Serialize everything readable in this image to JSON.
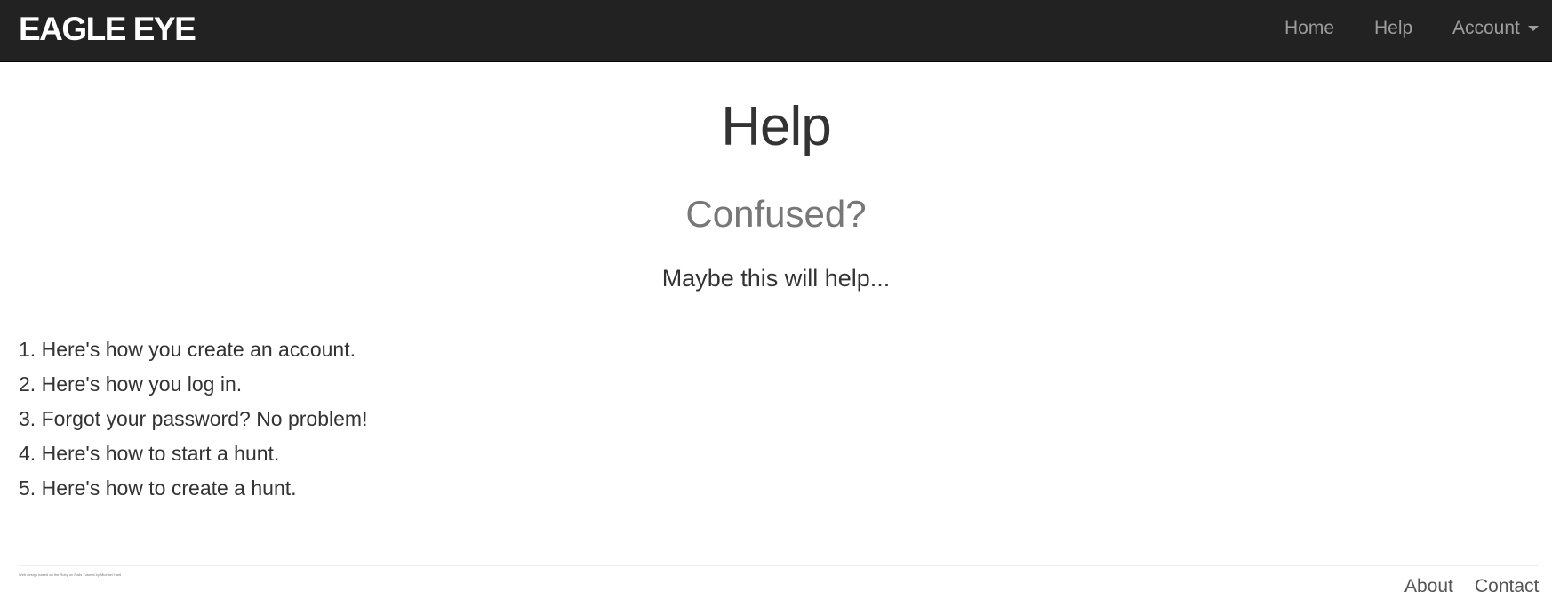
{
  "header": {
    "brand": "EAGLE EYE",
    "nav": {
      "home": "Home",
      "help": "Help",
      "account": "Account"
    }
  },
  "main": {
    "title": "Help",
    "subtitle": "Confused?",
    "intro": "Maybe this will help...",
    "items": [
      {
        "number": "1.",
        "text": "Here's how you create an account."
      },
      {
        "number": "2.",
        "text": "Here's how you log in."
      },
      {
        "number": "3.",
        "text": "Forgot your password? No problem!"
      },
      {
        "number": "4.",
        "text": "Here's how to start a hunt."
      },
      {
        "number": "5.",
        "text": "Here's how to create a hunt."
      }
    ]
  },
  "footer": {
    "credit": "Web design based on the Ruby on Rails Tutorial by Michael Hartl",
    "links": {
      "about": "About",
      "contact": "Contact"
    }
  },
  "colors": {
    "navbar_bg": "#222222",
    "nav_link": "#9d9d9d",
    "brand": "#ffffff",
    "subtitle": "#777777"
  }
}
